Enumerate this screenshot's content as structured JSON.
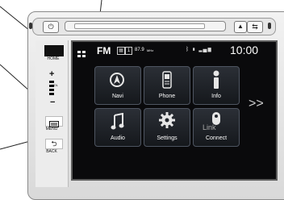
{
  "status_bar": {
    "source": "FM",
    "preset": "1",
    "frequency": "87.9",
    "frequency_unit": "MHz",
    "clock": "10:00"
  },
  "left_buttons": [
    {
      "label": "HOME",
      "icon": "home-icon"
    },
    {
      "label": "VOL",
      "icon": "volume-icon",
      "plus": "+",
      "minus": "−"
    },
    {
      "label": "MENU",
      "icon": "menu-icon"
    },
    {
      "label": "BACK",
      "icon": "back-icon"
    }
  ],
  "tiles": [
    {
      "label": "Navi",
      "icon": "navigation-icon"
    },
    {
      "label": "Phone",
      "icon": "phone-icon"
    },
    {
      "label": "Info",
      "icon": "info-icon"
    },
    {
      "label": "Audio",
      "icon": "music-note-icon"
    },
    {
      "label": "Settings",
      "icon": "gear-icon"
    },
    {
      "label": "Connect",
      "icon": "connect-icon",
      "overlay": "Link"
    }
  ],
  "more": ">>",
  "colors": {
    "screen_bg": "#0a0a0c",
    "tile_border": "#4e5561",
    "bezel": "#d9d9d9"
  }
}
